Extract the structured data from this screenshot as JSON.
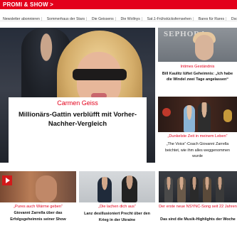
{
  "header": {
    "section_label": "PROMI & SHOW >"
  },
  "nav": {
    "items": [
      "Newsletter abonnieren",
      "Sommerhaus der Stars",
      "Die Geissens",
      "Die Wollnys",
      "Sat.1-Frühstücksfernsehen",
      "Bares für Rares",
      "Dschungelcamp"
    ]
  },
  "main_article": {
    "kicker": "Carmen Geiss",
    "title": "Millionärs-Gattin verblüfft mit Vorher-Nachher-Vergleich"
  },
  "side_articles": [
    {
      "sign_text": "SEPHORA",
      "kicker": "Intimes Geständnis",
      "title": "Bill Kaulitz lüftet Geheimnis: „Ich habe die Windel zwei Tage angelassen“"
    },
    {
      "kicker": "„Dunkelste Zeit in meinem Leben“",
      "title": "„The Voice“-Coach Giovanni Zarrella beichtet, wie ihm alles weggenommen wurde"
    }
  ],
  "bottom_articles": [
    {
      "kicker": "„Pures auch Wärme geben“",
      "title": "Giovanni Zarrella über das Erfolgsgeheimnis seiner Show"
    },
    {
      "kicker": "„Die lachen dich aus“",
      "title": "Lanz desillusioniert Precht über den Krieg in der Ukraine"
    },
    {
      "kicker": "Der erste neue NSYNC-Song seit 22 Jahren",
      "title": "Das sind die Musik-Highlights der Woche"
    }
  ],
  "colors": {
    "accent": "#e3001b",
    "text": "#111111"
  },
  "icons": {
    "play": "play-icon"
  }
}
